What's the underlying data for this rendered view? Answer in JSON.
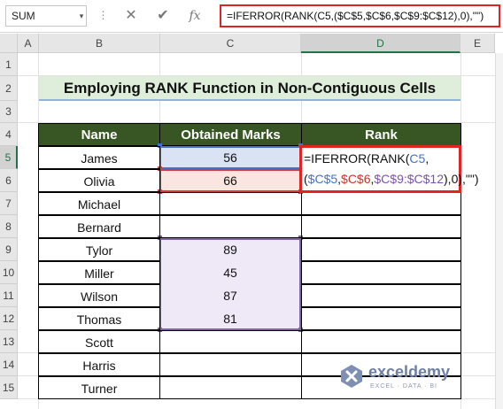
{
  "formula_bar": {
    "name_box": "SUM",
    "name_box_arrow": "▾",
    "dots": "⋮",
    "cancel_label": "✕",
    "enter_label": "✔",
    "fx_label": "fx",
    "formula": "=IFERROR(RANK(C5,($C$5,$C$6,$C$9:$C$12),0),\"\")",
    "highlight_color": "#e02424"
  },
  "columns": [
    "A",
    "B",
    "C",
    "D",
    "E"
  ],
  "active_column": "D",
  "rows": [
    "1",
    "2",
    "3",
    "4",
    "5",
    "6",
    "7",
    "8",
    "9",
    "10",
    "11",
    "12",
    "13",
    "14",
    "15"
  ],
  "active_row": "5",
  "title": "Employing RANK Function in Non-Contiguous Cells",
  "table": {
    "headers": [
      "Name",
      "Obtained Marks",
      "Rank"
    ],
    "header_color": "#375623",
    "rows": [
      {
        "name": "James",
        "marks": "56"
      },
      {
        "name": "Olivia",
        "marks": "66"
      },
      {
        "name": "Michael",
        "marks": ""
      },
      {
        "name": "Bernard",
        "marks": ""
      },
      {
        "name": "Tylor",
        "marks": "89"
      },
      {
        "name": "Miller",
        "marks": "45"
      },
      {
        "name": "Wilson",
        "marks": "87"
      },
      {
        "name": "Thomas",
        "marks": "81"
      },
      {
        "name": "Scott",
        "marks": ""
      },
      {
        "name": "Harris",
        "marks": ""
      },
      {
        "name": "Turner",
        "marks": ""
      }
    ]
  },
  "edit_cell": {
    "p1": "=IFERROR(RANK(",
    "p2": "C5",
    "p3": ",(",
    "p4": "$C$5",
    "p5": ",",
    "p6": "$C$6",
    "p7": ",",
    "p8": "$C$9:$C$12",
    "p9": "),0),\"\")"
  },
  "reference_colors": {
    "c5": "#4472c4",
    "c6": "#c0392b",
    "c9_c12": "#7b52ab"
  },
  "watermark": {
    "name": "exceldemy",
    "tagline": "EXCEL · DATA · BI"
  }
}
